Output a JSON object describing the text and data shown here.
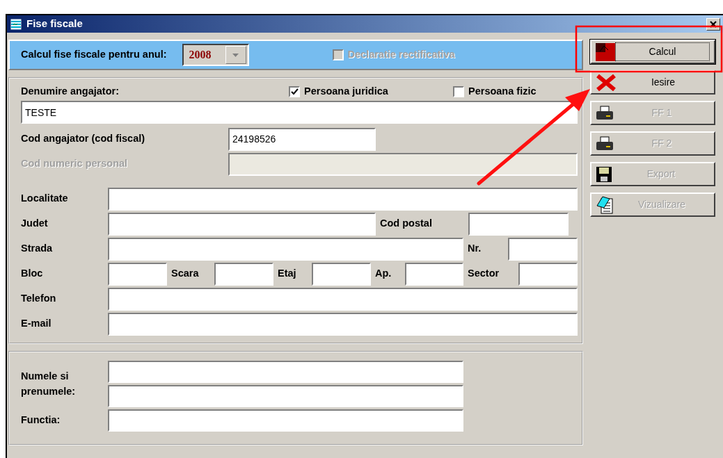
{
  "window": {
    "title": "Fise fiscale"
  },
  "year_bar": {
    "label": "Calcul fise fiscale pentru anul:",
    "year": "2008",
    "rectificativa": {
      "label": "Declaratie rectificativa",
      "checked": false,
      "disabled": true
    }
  },
  "employer": {
    "label": "Denumire angajator:",
    "options": [
      {
        "label": "Persoana juridica",
        "checked": true
      },
      {
        "label": "Persoana fizic",
        "checked": false
      }
    ],
    "value": "TESTE"
  },
  "id_rows": [
    {
      "disabled": false,
      "items": [
        {
          "kind": "label",
          "text": "Cod angajator (cod fiscal)"
        },
        {
          "kind": "input",
          "value": "24198526"
        }
      ]
    },
    {
      "disabled": true,
      "items": [
        {
          "kind": "label",
          "text": "Cod numeric personal"
        },
        {
          "kind": "input"
        }
      ]
    }
  ],
  "address_rows": [
    {
      "disabled": false,
      "items": [
        {
          "kind": "label",
          "text": "Localitate"
        },
        {
          "kind": "input"
        }
      ]
    },
    {
      "disabled": false,
      "items": [
        {
          "kind": "label",
          "text": "Judet"
        },
        {
          "kind": "input"
        },
        {
          "kind": "label",
          "text": "Cod postal"
        },
        {
          "kind": "input"
        }
      ]
    },
    {
      "disabled": false,
      "items": [
        {
          "kind": "label",
          "text": "Strada"
        },
        {
          "kind": "input"
        },
        {
          "kind": "label",
          "text": "Nr."
        },
        {
          "kind": "input"
        }
      ]
    },
    {
      "disabled": false,
      "items": [
        {
          "kind": "label",
          "text": "Bloc"
        },
        {
          "kind": "input"
        },
        {
          "kind": "label",
          "text": "Scara"
        },
        {
          "kind": "input"
        },
        {
          "kind": "label",
          "text": "Etaj"
        },
        {
          "kind": "input"
        },
        {
          "kind": "label",
          "text": "Ap."
        },
        {
          "kind": "input"
        },
        {
          "kind": "label",
          "text": "Sector"
        },
        {
          "kind": "input"
        }
      ]
    },
    {
      "disabled": false,
      "items": [
        {
          "kind": "label",
          "text": "Telefon"
        },
        {
          "kind": "input"
        }
      ]
    },
    {
      "disabled": false,
      "items": [
        {
          "kind": "label",
          "text": "E-mail"
        },
        {
          "kind": "input"
        }
      ]
    }
  ],
  "signatory": {
    "name_label": "Numele si prenumele:",
    "function_label": "Functia:"
  },
  "buttons": [
    {
      "label": "Calcul",
      "disabled": false,
      "focused": true
    },
    {
      "label": "Iesire",
      "disabled": false,
      "focused": false
    },
    {
      "label": "FF 1",
      "disabled": true,
      "focused": false
    },
    {
      "label": "FF 2",
      "disabled": true,
      "focused": false
    },
    {
      "label": "Export",
      "disabled": true,
      "focused": false
    },
    {
      "label": "Vizualizare",
      "disabled": true,
      "focused": false
    }
  ]
}
